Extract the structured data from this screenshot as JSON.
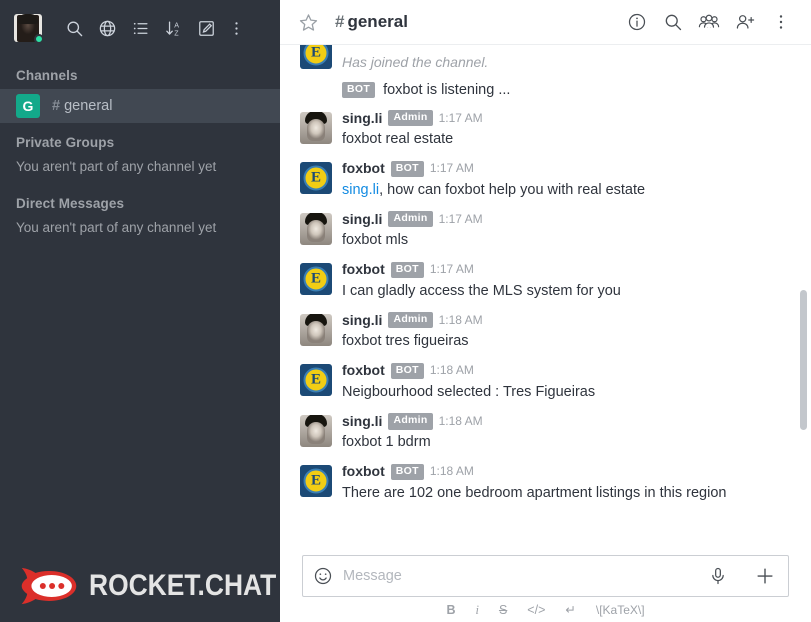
{
  "sidebar": {
    "user": {
      "status": "online"
    },
    "toolbar_icons": [
      {
        "name": "search-icon",
        "label": "Search"
      },
      {
        "name": "globe-icon",
        "label": "Directory"
      },
      {
        "name": "list-icon",
        "label": "Channel list"
      },
      {
        "name": "sort-az-icon",
        "label": "Sort"
      },
      {
        "name": "create-new-icon",
        "label": "Create new"
      },
      {
        "name": "kebab-menu-icon",
        "label": "Options"
      }
    ],
    "sections": [
      {
        "title": "Channels",
        "empty_text": "",
        "channels": [
          {
            "badge": "G",
            "hash": "#",
            "name": "general",
            "active": true
          }
        ]
      },
      {
        "title": "Private Groups",
        "empty_text": "You aren't part of any channel yet",
        "channels": []
      },
      {
        "title": "Direct Messages",
        "empty_text": "You aren't part of any channel yet",
        "channels": []
      }
    ],
    "logo_text": "ROCKET.CHAT"
  },
  "header": {
    "hash": "#",
    "title": "general",
    "star_label": "Favorite",
    "actions": [
      {
        "name": "info-icon",
        "label": "Info"
      },
      {
        "name": "search-icon",
        "label": "Search Messages"
      },
      {
        "name": "members-icon",
        "label": "Members List"
      },
      {
        "name": "add-user-icon",
        "label": "Add Users"
      },
      {
        "name": "kebab-menu-icon",
        "label": "Options"
      }
    ]
  },
  "messages": [
    {
      "type": "system",
      "avatar": "bot",
      "text": "Has joined the channel.",
      "partial_top": true
    },
    {
      "type": "inline-bot",
      "tag": "BOT",
      "text": "foxbot is listening ..."
    },
    {
      "type": "message",
      "avatar": "person",
      "user": "sing.li",
      "tag": "Admin",
      "time": "1:17 AM",
      "text": "foxbot real estate"
    },
    {
      "type": "message",
      "avatar": "bot",
      "user": "foxbot",
      "tag": "BOT",
      "time": "1:17 AM",
      "mention": "sing.li",
      "text": ", how can foxbot help you with real estate"
    },
    {
      "type": "message",
      "avatar": "person",
      "user": "sing.li",
      "tag": "Admin",
      "time": "1:17 AM",
      "text": "foxbot mls"
    },
    {
      "type": "message",
      "avatar": "bot",
      "user": "foxbot",
      "tag": "BOT",
      "time": "1:17 AM",
      "text": "I can gladly access the MLS system for you"
    },
    {
      "type": "message",
      "avatar": "person",
      "user": "sing.li",
      "tag": "Admin",
      "time": "1:18 AM",
      "text": "foxbot tres figueiras"
    },
    {
      "type": "message",
      "avatar": "bot",
      "user": "foxbot",
      "tag": "BOT",
      "time": "1:18 AM",
      "text": "Neigbourhood selected : Tres Figueiras"
    },
    {
      "type": "message",
      "avatar": "person",
      "user": "sing.li",
      "tag": "Admin",
      "time": "1:18 AM",
      "text": "foxbot 1 bdrm"
    },
    {
      "type": "message",
      "avatar": "bot",
      "user": "foxbot",
      "tag": "BOT",
      "time": "1:18 AM",
      "text": "There are 102 one bedroom apartment listings in this region"
    }
  ],
  "composer": {
    "placeholder": "Message",
    "value": "",
    "emoji_label": "Emoji",
    "audio_label": "Audio message",
    "plus_label": "Plus actions",
    "tools": [
      {
        "name": "bold-button",
        "label": "B",
        "style": "b"
      },
      {
        "name": "italic-button",
        "label": "i",
        "style": "i"
      },
      {
        "name": "strike-button",
        "label": "S",
        "style": "s"
      },
      {
        "name": "code-button",
        "label": "</>",
        "style": "c"
      },
      {
        "name": "multiline-button",
        "label": "↵",
        "style": "c"
      },
      {
        "name": "katex-button",
        "label": "\\[KaTeX\\]",
        "style": "katex"
      }
    ]
  },
  "colors": {
    "sidebar_bg": "#2f343d",
    "sidebar_active": "#414852",
    "channel_badge": "#13a98a",
    "mention_link": "#138be2",
    "status_online": "#2de0a5",
    "bot_tag": "#9ea2a8",
    "logo_red": "#db2f2a"
  }
}
